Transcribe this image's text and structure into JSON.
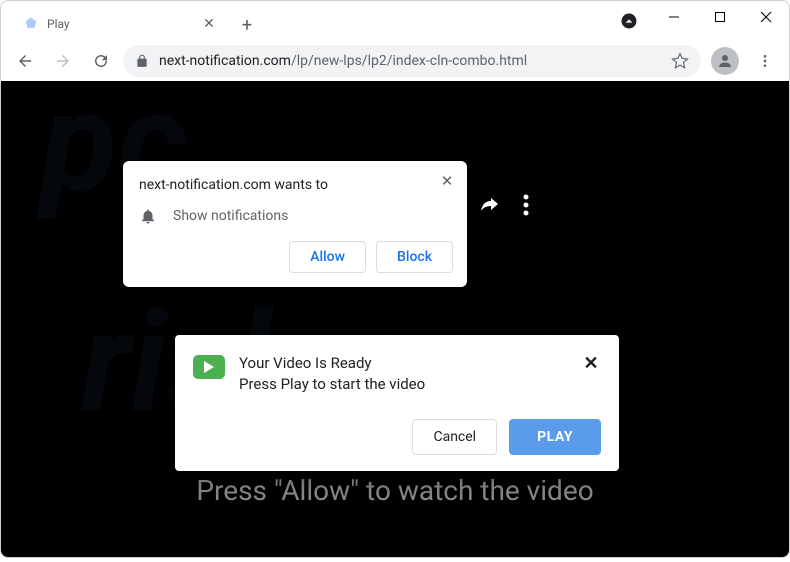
{
  "tab": {
    "title": "Play"
  },
  "url": {
    "domain": "next-notification.com",
    "path": "/lp/new-lps/lp2/index-cln-combo.html"
  },
  "permission": {
    "prompt": "next-notification.com wants to",
    "request": "Show notifications",
    "allow": "Allow",
    "block": "Block"
  },
  "modal": {
    "line1": "Your Video Is Ready",
    "line2": "Press Play to start the video",
    "cancel": "Cancel",
    "play": "PLAY"
  },
  "background": {
    "message": "Press \"Allow\" to watch the video"
  }
}
